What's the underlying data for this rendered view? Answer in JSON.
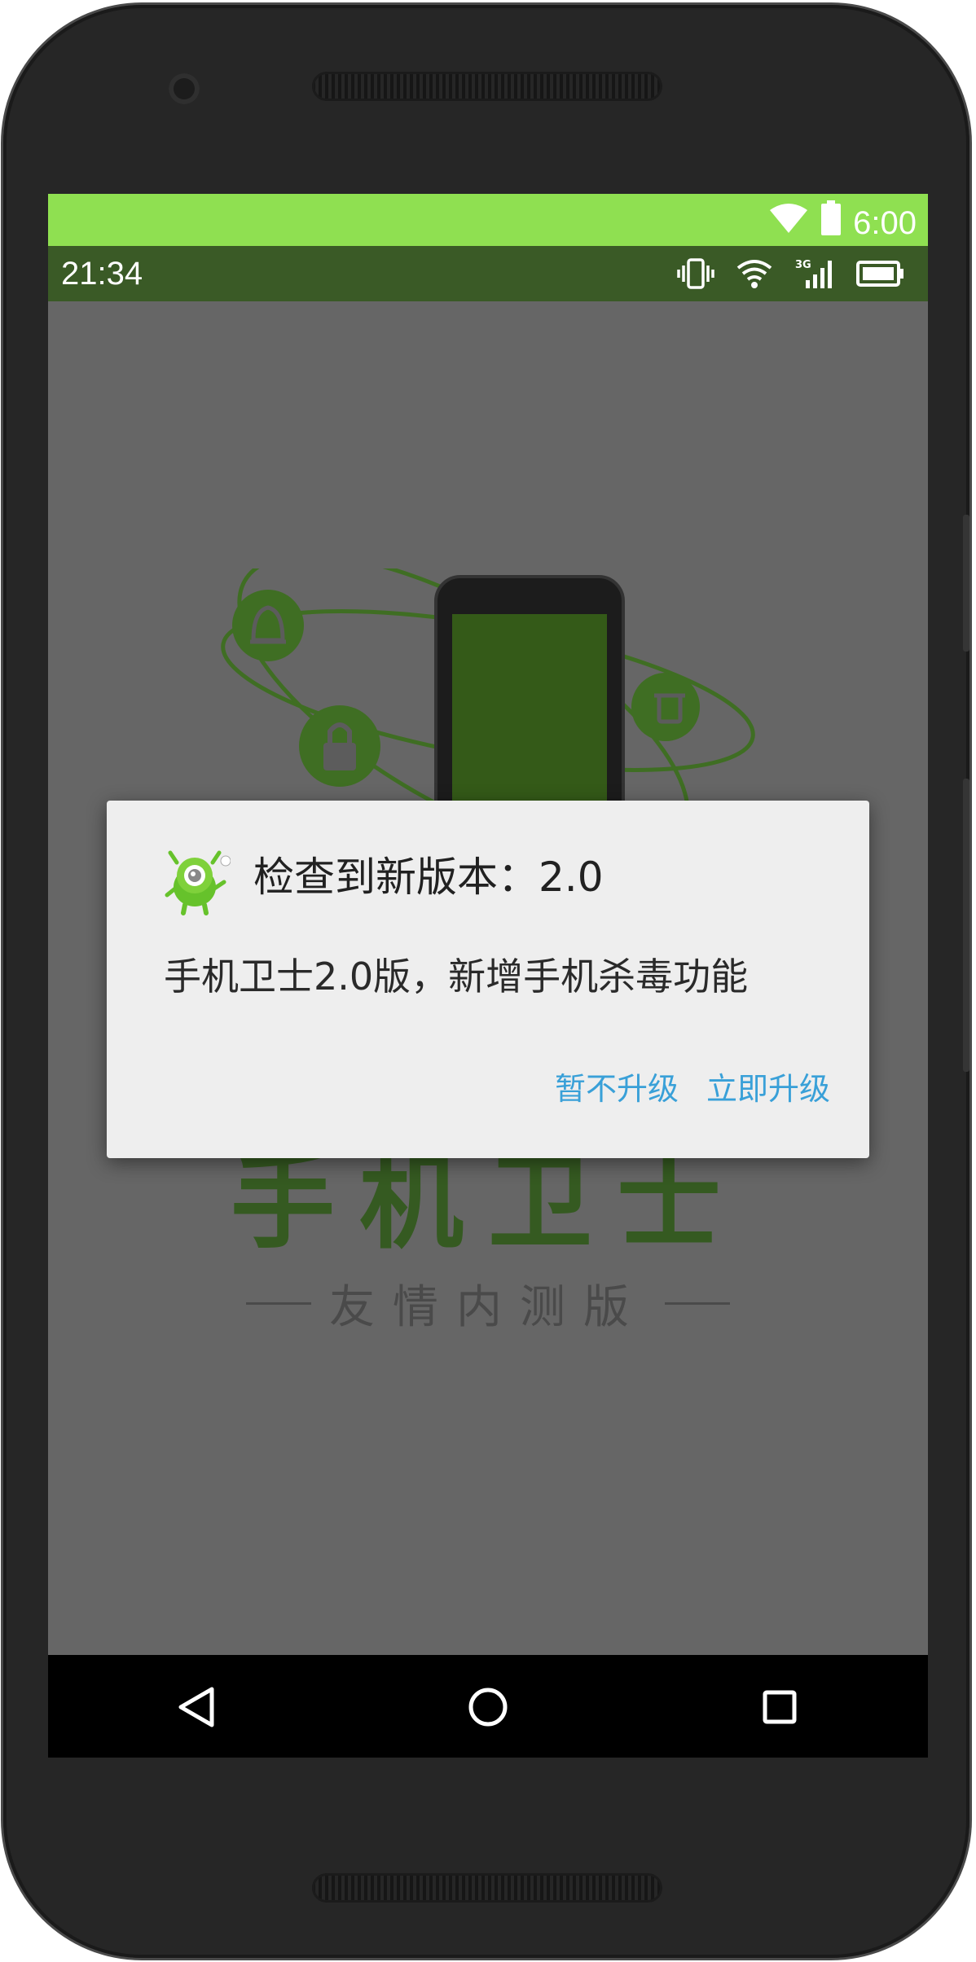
{
  "host_status": {
    "time": "6:00",
    "wifi_icon": "wifi-icon",
    "battery_icon": "battery-icon"
  },
  "status_bar": {
    "time": "21:34"
  },
  "splash": {
    "title": "手机卫士",
    "subtitle": "友情内测版"
  },
  "dialog": {
    "title": "检查到新版本：2.0",
    "message": "手机卫士2.0版，新增手机杀毒功能",
    "negative": "暂不升级",
    "positive": "立即升级"
  },
  "nav": {
    "back": "back-icon",
    "home": "home-icon",
    "recents": "recents-icon"
  },
  "colors": {
    "accent": "#39a0d8",
    "host_bar": "#8fe051",
    "status_bar": "#3a5a26",
    "brand_green": "#335a1e"
  }
}
